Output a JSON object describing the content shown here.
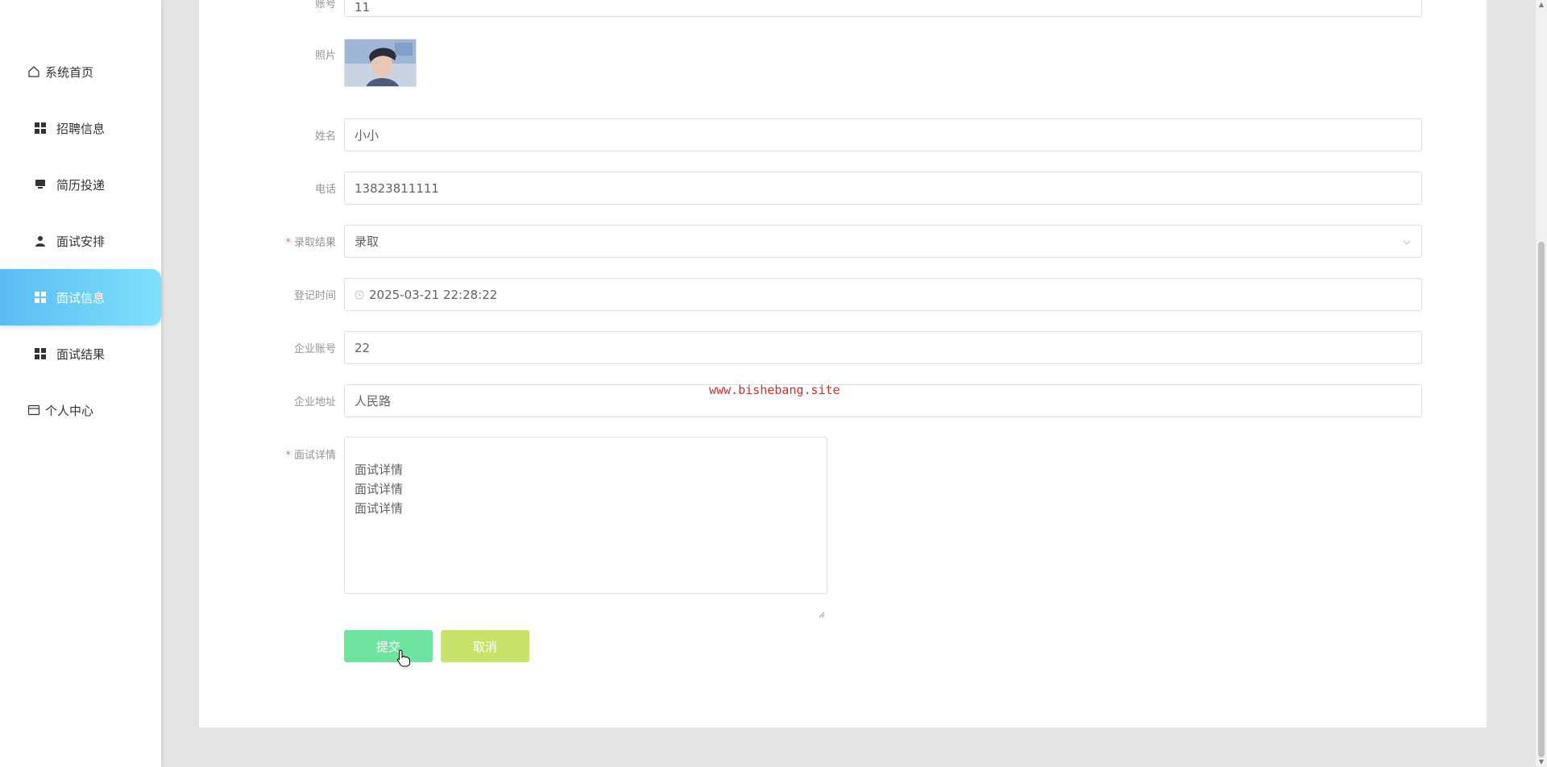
{
  "sidebar": {
    "items": [
      {
        "label": "系统首页",
        "icon": "home-icon"
      },
      {
        "label": "招聘信息",
        "icon": "grid-icon"
      },
      {
        "label": "简历投递",
        "icon": "monitor-icon"
      },
      {
        "label": "面试安排",
        "icon": "user-icon"
      },
      {
        "label": "面试信息",
        "icon": "grid-icon",
        "active": true
      },
      {
        "label": "面试结果",
        "icon": "grid-icon"
      },
      {
        "label": "个人中心",
        "icon": "card-icon"
      }
    ]
  },
  "form": {
    "account": {
      "label": "账号",
      "value": "11"
    },
    "photo": {
      "label": "照片"
    },
    "name": {
      "label": "姓名",
      "value": "小小"
    },
    "phone": {
      "label": "电话",
      "value": "13823811111"
    },
    "result": {
      "label": "录取结果",
      "value": "录取",
      "required": "*"
    },
    "time": {
      "label": "登记时间",
      "value": "2025-03-21 22:28:22"
    },
    "company_account": {
      "label": "企业账号",
      "value": "22"
    },
    "company_address": {
      "label": "企业地址",
      "value": "人民路"
    },
    "details": {
      "label": "面试详情",
      "value": "面试详情\n面试详情\n面试详情",
      "required": "*"
    }
  },
  "buttons": {
    "submit": "提交",
    "cancel": "取消"
  },
  "watermark": "www.bishebang.site",
  "colors": {
    "accent": "#5bbcf3",
    "submit": "#6fe3a0",
    "cancel": "#c8e36a",
    "required": "#f56c6c"
  }
}
